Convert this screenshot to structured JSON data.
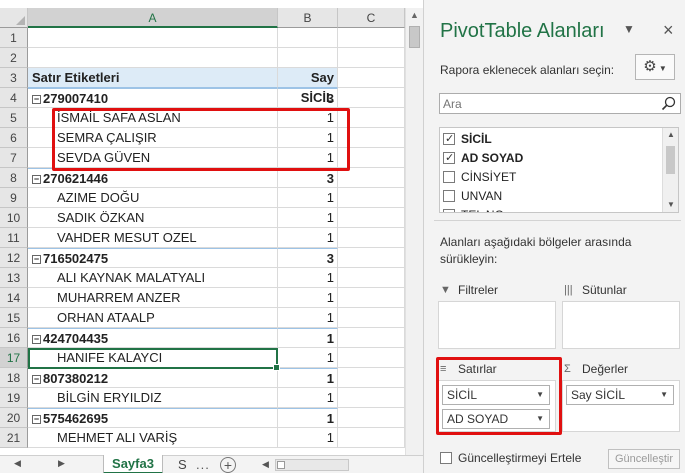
{
  "sheet": {
    "columns": [
      "A",
      "B",
      "C"
    ],
    "selected_column": "A",
    "selected_row": "17",
    "rows": [
      {
        "n": "1",
        "a": "",
        "b": "",
        "type": "empty"
      },
      {
        "n": "2",
        "a": "",
        "b": "",
        "type": "empty"
      },
      {
        "n": "3",
        "a": "Satır Etiketleri",
        "b": "Say SİCİL",
        "type": "hdr"
      },
      {
        "n": "4",
        "a": "279007410",
        "b": "3",
        "type": "grp"
      },
      {
        "n": "5",
        "a": "İSMAİL SAFA ASLAN",
        "b": "1",
        "type": "child"
      },
      {
        "n": "6",
        "a": "SEMRA ÇALIŞIR",
        "b": "1",
        "type": "child"
      },
      {
        "n": "7",
        "a": "SEVDA GÜVEN",
        "b": "1",
        "type": "child"
      },
      {
        "n": "8",
        "a": "270621446",
        "b": "3",
        "type": "grp"
      },
      {
        "n": "9",
        "a": "AZIME DOĞU",
        "b": "1",
        "type": "child"
      },
      {
        "n": "10",
        "a": "SADIK ÖZKAN",
        "b": "1",
        "type": "child"
      },
      {
        "n": "11",
        "a": "VAHDER MESUT OZEL",
        "b": "1",
        "type": "child"
      },
      {
        "n": "12",
        "a": "716502475",
        "b": "3",
        "type": "grp"
      },
      {
        "n": "13",
        "a": "ALI KAYNAK MALATYALI",
        "b": "1",
        "type": "child"
      },
      {
        "n": "14",
        "a": "MUHARREM ANZER",
        "b": "1",
        "type": "child"
      },
      {
        "n": "15",
        "a": "ORHAN ATAALP",
        "b": "1",
        "type": "child"
      },
      {
        "n": "16",
        "a": "424704435",
        "b": "1",
        "type": "grp"
      },
      {
        "n": "17",
        "a": "HANIFE KALAYCI",
        "b": "1",
        "type": "child"
      },
      {
        "n": "18",
        "a": "807380212",
        "b": "1",
        "type": "grp"
      },
      {
        "n": "19",
        "a": "BİLGİN ERYILDIZ",
        "b": "1",
        "type": "child"
      },
      {
        "n": "20",
        "a": "575462695",
        "b": "1",
        "type": "grp"
      },
      {
        "n": "21",
        "a": "MEHMET ALI VARİŞ",
        "b": "1",
        "type": "child"
      }
    ],
    "tabs": {
      "active": "Sayfa3",
      "next_partial": "S",
      "more": "...",
      "add": "+"
    }
  },
  "pane": {
    "title": "PivotTable Alanları",
    "subtitle": "Rapora eklenecek alanları seçin:",
    "search_placeholder": "Ara",
    "fields": [
      {
        "label": "SİCİL",
        "checked": true
      },
      {
        "label": "AD SOYAD",
        "checked": true
      },
      {
        "label": "CİNSİYET",
        "checked": false
      },
      {
        "label": "UNVAN",
        "checked": false
      },
      {
        "label": "TEL NO",
        "checked": false
      }
    ],
    "drag_text": "Alanları aşağıdaki bölgeler arasında sürükleyin:",
    "areas": {
      "filters": {
        "title": "Filtreler",
        "items": []
      },
      "columns": {
        "title": "Sütunlar",
        "items": []
      },
      "rows": {
        "title": "Satırlar",
        "items": [
          "SİCİL",
          "AD SOYAD"
        ]
      },
      "values": {
        "title": "Değerler",
        "items": [
          "Say SİCİL"
        ]
      }
    },
    "defer_label": "Güncelleştirmeyi Ertele",
    "update_label": "Güncelleştir"
  },
  "colors": {
    "excel_green": "#217346",
    "highlight_red": "#e01010",
    "pivot_header_bg": "#ddebf7"
  }
}
